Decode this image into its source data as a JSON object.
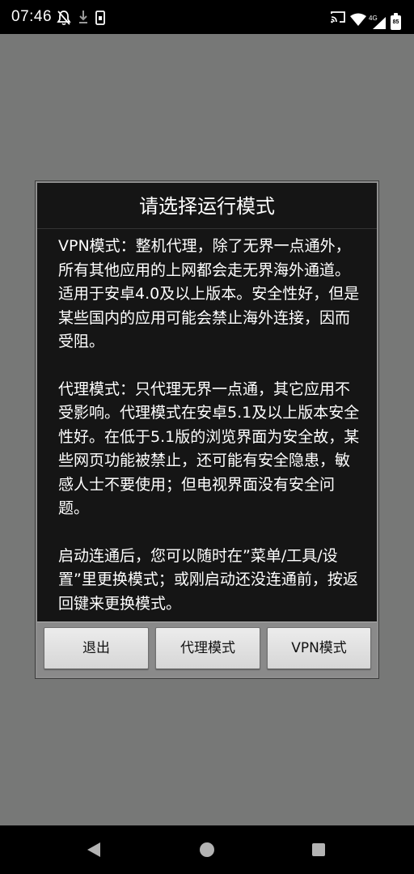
{
  "status_bar": {
    "time": "07:46",
    "network_type": "4G",
    "battery_level": "85",
    "icons_left": [
      "notifications-off-icon",
      "download-icon",
      "sim-card-icon"
    ],
    "icons_right": [
      "cast-icon",
      "wifi-icon",
      "signal-icon",
      "battery-icon"
    ]
  },
  "dialog": {
    "title": "请选择运行模式",
    "paragraphs": [
      "VPN模式：整机代理，除了无界一点通外，所有其他应用的上网都会走无界海外通道。适用于安卓4.0及以上版本。安全性好，但是某些国内的应用可能会禁止海外连接，因而受阻。",
      "代理模式：只代理无界一点通，其它应用不受影响。代理模式在安卓5.1及以上版本安全性好。在低于5.1版的浏览界面为安全故，某些网页功能被禁止，还可能有安全隐患，敏感人士不要使用；但电视界面没有安全问题。",
      "启动连通后，您可以随时在”菜单/工具/设置”里更换模式；或刚启动还没连通前，按返回键来更换模式。"
    ],
    "buttons": {
      "exit": "退出",
      "proxy_mode": "代理模式",
      "vpn_mode": "VPN模式"
    }
  },
  "nav_bar": {
    "icons": [
      "back-icon",
      "home-icon",
      "recents-icon"
    ]
  },
  "colors": {
    "dim_background": "#777877",
    "dialog_background": "#151515",
    "button_bar": "#8a8a8a",
    "button_face": "#e4e4e4"
  }
}
